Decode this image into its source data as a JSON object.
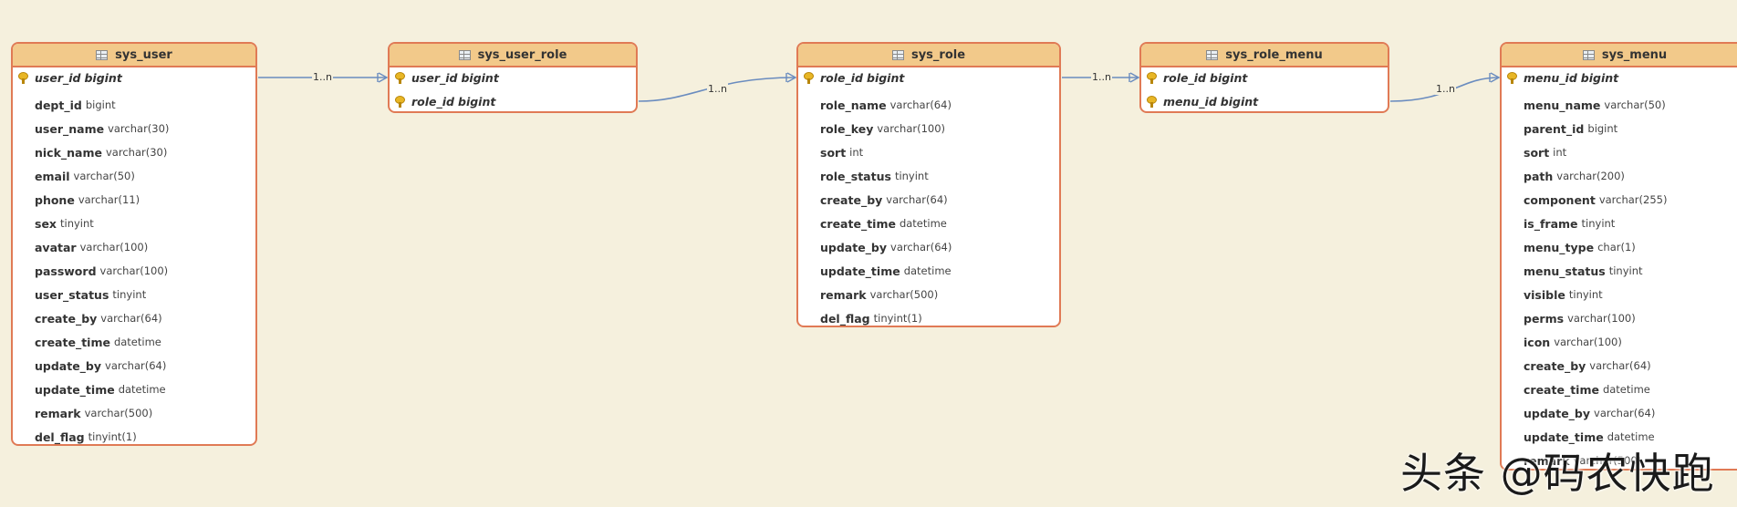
{
  "entities": {
    "sys_user": {
      "title": "sys_user",
      "pk": [
        {
          "name": "user_id",
          "type": "bigint"
        }
      ],
      "fields": [
        {
          "name": "dept_id",
          "type": "bigint"
        },
        {
          "name": "user_name",
          "type": "varchar(30)"
        },
        {
          "name": "nick_name",
          "type": "varchar(30)"
        },
        {
          "name": "email",
          "type": "varchar(50)"
        },
        {
          "name": "phone",
          "type": "varchar(11)"
        },
        {
          "name": "sex",
          "type": "tinyint"
        },
        {
          "name": "avatar",
          "type": "varchar(100)"
        },
        {
          "name": "password",
          "type": "varchar(100)"
        },
        {
          "name": "user_status",
          "type": "tinyint"
        },
        {
          "name": "create_by",
          "type": "varchar(64)"
        },
        {
          "name": "create_time",
          "type": "datetime"
        },
        {
          "name": "update_by",
          "type": "varchar(64)"
        },
        {
          "name": "update_time",
          "type": "datetime"
        },
        {
          "name": "remark",
          "type": "varchar(500)"
        },
        {
          "name": "del_flag",
          "type": "tinyint(1)"
        }
      ]
    },
    "sys_user_role": {
      "title": "sys_user_role",
      "pk": [
        {
          "name": "user_id",
          "type": "bigint"
        },
        {
          "name": "role_id",
          "type": "bigint"
        }
      ],
      "fields": []
    },
    "sys_role": {
      "title": "sys_role",
      "pk": [
        {
          "name": "role_id",
          "type": "bigint"
        }
      ],
      "fields": [
        {
          "name": "role_name",
          "type": "varchar(64)"
        },
        {
          "name": "role_key",
          "type": "varchar(100)"
        },
        {
          "name": "sort",
          "type": "int"
        },
        {
          "name": "role_status",
          "type": "tinyint"
        },
        {
          "name": "create_by",
          "type": "varchar(64)"
        },
        {
          "name": "create_time",
          "type": "datetime"
        },
        {
          "name": "update_by",
          "type": "varchar(64)"
        },
        {
          "name": "update_time",
          "type": "datetime"
        },
        {
          "name": "remark",
          "type": "varchar(500)"
        },
        {
          "name": "del_flag",
          "type": "tinyint(1)"
        }
      ]
    },
    "sys_role_menu": {
      "title": "sys_role_menu",
      "pk": [
        {
          "name": "role_id",
          "type": "bigint"
        },
        {
          "name": "menu_id",
          "type": "bigint"
        }
      ],
      "fields": []
    },
    "sys_menu": {
      "title": "sys_menu",
      "pk": [
        {
          "name": "menu_id",
          "type": "bigint"
        }
      ],
      "fields": [
        {
          "name": "menu_name",
          "type": "varchar(50)"
        },
        {
          "name": "parent_id",
          "type": "bigint"
        },
        {
          "name": "sort",
          "type": "int"
        },
        {
          "name": "path",
          "type": "varchar(200)"
        },
        {
          "name": "component",
          "type": "varchar(255)"
        },
        {
          "name": "is_frame",
          "type": "tinyint"
        },
        {
          "name": "menu_type",
          "type": "char(1)"
        },
        {
          "name": "menu_status",
          "type": "tinyint"
        },
        {
          "name": "visible",
          "type": "tinyint"
        },
        {
          "name": "perms",
          "type": "varchar(100)"
        },
        {
          "name": "icon",
          "type": "varchar(100)"
        },
        {
          "name": "create_by",
          "type": "varchar(64)"
        },
        {
          "name": "create_time",
          "type": "datetime"
        },
        {
          "name": "update_by",
          "type": "varchar(64)"
        },
        {
          "name": "update_time",
          "type": "datetime"
        },
        {
          "name": "remark",
          "type": "varchar(500)"
        }
      ]
    }
  },
  "relations": [
    {
      "from": "sys_user",
      "to": "sys_user_role",
      "label": "1..n"
    },
    {
      "from": "sys_user_role",
      "to": "sys_role",
      "label": "1..n"
    },
    {
      "from": "sys_role",
      "to": "sys_role_menu",
      "label": "1..n"
    },
    {
      "from": "sys_role_menu",
      "to": "sys_menu",
      "label": "1..n"
    }
  ],
  "watermark": "头条 @码农快跑",
  "colors": {
    "background": "#f5f0dd",
    "entity_border": "#e07a55",
    "entity_header": "#f2c98a",
    "connector": "#6a8cbf",
    "key": "#e8b625"
  }
}
